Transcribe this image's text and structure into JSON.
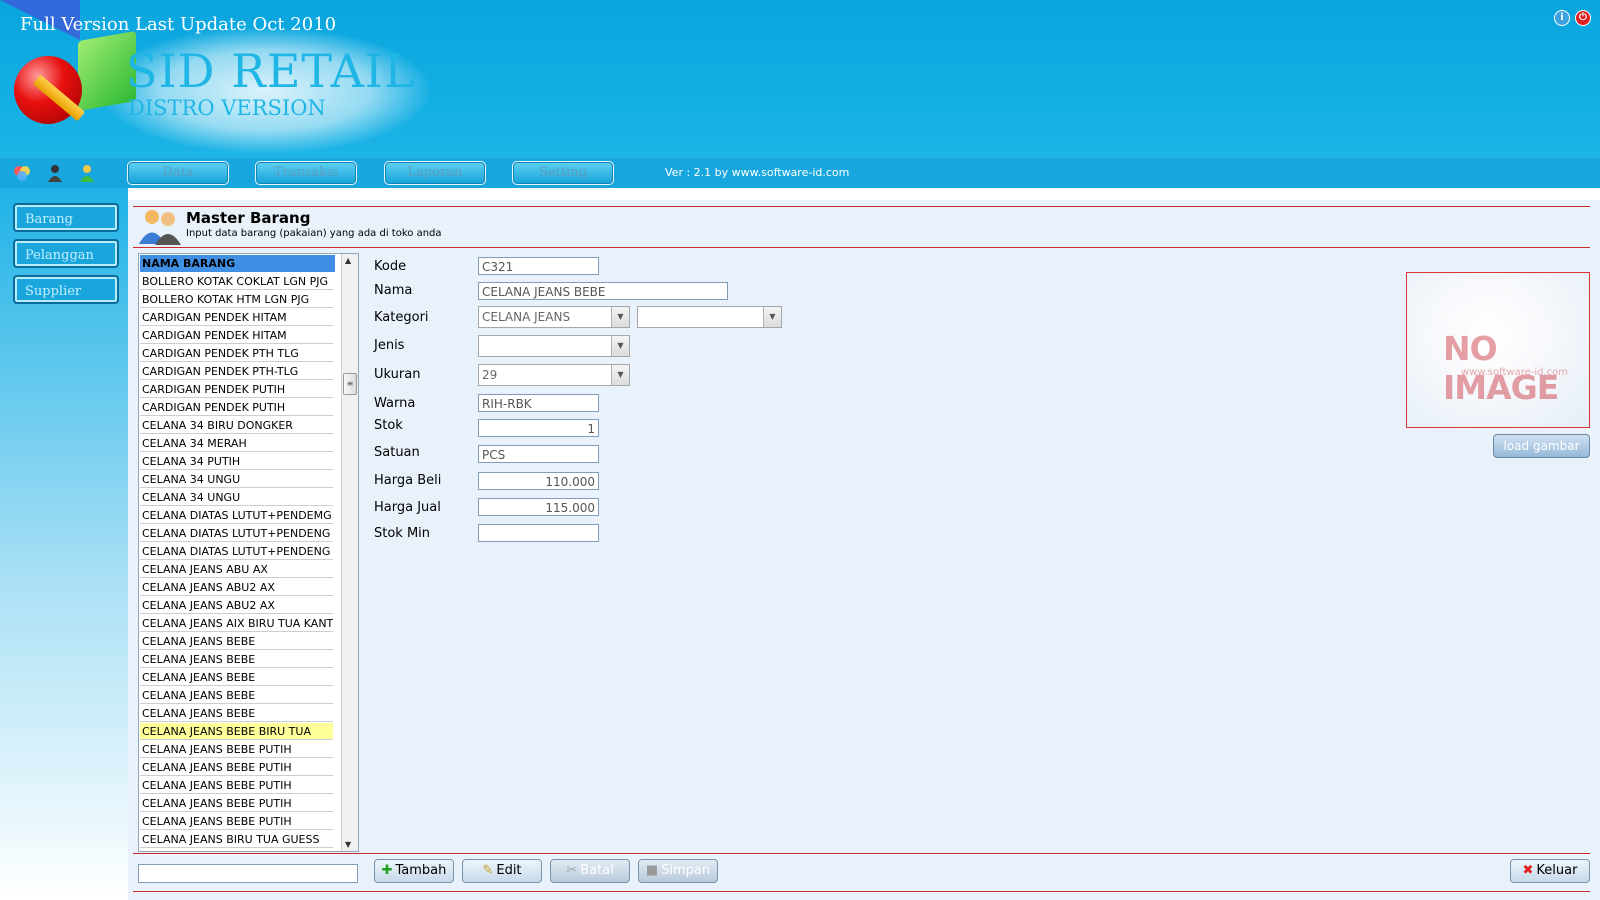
{
  "banner": {
    "update_text": "Full Version Last Update Oct 2010",
    "title": "SID RETAIL",
    "subtitle": "DISTRO VERSION"
  },
  "window_icons": [
    "info-icon",
    "power-icon"
  ],
  "menu": {
    "icons": [
      "colors-icon",
      "user-dark-icon",
      "user-green-icon"
    ],
    "items": [
      "Data",
      "Transaksi",
      "Laporan",
      "Setting"
    ],
    "version": "Ver : 2.1 by www.software-id.com"
  },
  "sidebar": {
    "items": [
      "Barang",
      "Pelanggan",
      "Supplier"
    ]
  },
  "header": {
    "title": "Master Barang",
    "subtitle": "Input data barang (pakaian) yang ada di toko anda"
  },
  "list": {
    "header": "NAMA BARANG",
    "selected_index": 25,
    "items": [
      "BOLLERO KOTAK COKLAT LGN PJG",
      "BOLLERO KOTAK HTM LGN PJG",
      "CARDIGAN PENDEK HITAM",
      "CARDIGAN PENDEK HITAM",
      "CARDIGAN PENDEK PTH TLG",
      "CARDIGAN PENDEK PTH-TLG",
      "CARDIGAN PENDEK PUTIH",
      "CARDIGAN PENDEK PUTIH",
      "CELANA 34 BIRU DONGKER",
      "CELANA 34 MERAH",
      "CELANA 34 PUTIH",
      "CELANA 34 UNGU",
      "CELANA 34 UNGU",
      "CELANA DIATAS LUTUT+PENDEMG S",
      "CELANA DIATAS LUTUT+PENDENG S",
      "CELANA DIATAS LUTUT+PENDENG S",
      "CELANA JEANS ABU AX",
      "CELANA JEANS ABU2 AX",
      "CELANA JEANS ABU2 AX",
      "CELANA JEANS AIX BIRU TUA KANTC",
      "CELANA JEANS BEBE",
      "CELANA JEANS BEBE",
      "CELANA JEANS BEBE",
      "CELANA JEANS BEBE",
      "CELANA JEANS BEBE",
      "CELANA JEANS BEBE BIRU TUA",
      "CELANA JEANS BEBE PUTIH",
      "CELANA JEANS BEBE PUTIH",
      "CELANA JEANS BEBE PUTIH",
      "CELANA JEANS BEBE PUTIH",
      "CELANA JEANS BEBE PUTIH",
      "CELANA JEANS BIRU TUA GUESS"
    ]
  },
  "form": {
    "kode": {
      "label": "Kode",
      "value": "C321"
    },
    "nama": {
      "label": "Nama",
      "value": "CELANA JEANS BEBE"
    },
    "kategori": {
      "label": "Kategori",
      "value": "CELANA JEANS",
      "value2": ""
    },
    "jenis": {
      "label": "Jenis",
      "value": ""
    },
    "ukuran": {
      "label": "Ukuran",
      "value": "29"
    },
    "warna": {
      "label": "Warna",
      "value": "RIH-RBK"
    },
    "stok": {
      "label": "Stok",
      "value": "1"
    },
    "satuan": {
      "label": "Satuan",
      "value": "PCS"
    },
    "harga_beli": {
      "label": "Harga Beli",
      "value": "110.000"
    },
    "harga_jual": {
      "label": "Harga Jual",
      "value": "115.000"
    },
    "stok_min": {
      "label": "Stok Min",
      "value": ""
    }
  },
  "image": {
    "no_image_text": "NO IMAGE",
    "url_text": "www.software-id.com",
    "load_button": "load gambar"
  },
  "actions": {
    "search_value": "",
    "tambah": "Tambah",
    "edit": "Edit",
    "batal": "Batal",
    "simpan": "Simpan",
    "keluar": "Keluar"
  },
  "colors": {
    "banner": "#0aa5de",
    "selected_row": "#ffff99",
    "accent_line": "#cd2a2a"
  }
}
